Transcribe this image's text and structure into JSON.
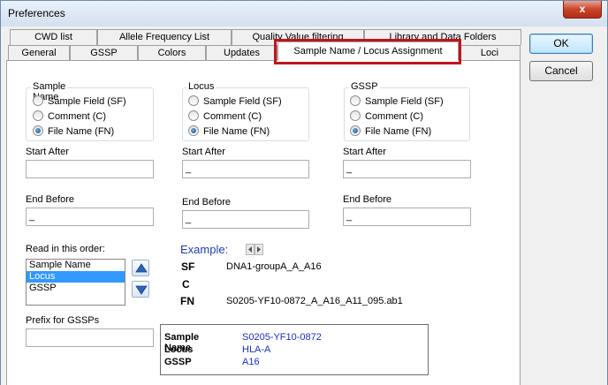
{
  "window": {
    "title": "Preferences",
    "close_glyph": "x"
  },
  "tabs_row_back": [
    "CWD list",
    "Allele Frequency List",
    "Quality Value filtering",
    "Library and Data Folders"
  ],
  "tabs_row_front": [
    "General",
    "GSSP",
    "Colors",
    "Updates",
    "Sample Name / Locus Assignment",
    "Loci"
  ],
  "buttons": {
    "ok": "OK",
    "cancel": "Cancel"
  },
  "groups": {
    "sample_name": {
      "label": "Sample Name",
      "options": [
        "Sample Field (SF)",
        "Comment (C)",
        "File Name (FN)"
      ],
      "selected": "File Name (FN)"
    },
    "locus": {
      "label": "Locus",
      "options": [
        "Sample Field (SF)",
        "Comment (C)",
        "File Name (FN)"
      ],
      "selected": "File Name (FN)"
    },
    "gssp": {
      "label": "GSSP",
      "options": [
        "Sample Field (SF)",
        "Comment (C)",
        "File Name (FN)"
      ],
      "selected": "File Name (FN)"
    }
  },
  "fields": {
    "start_after_label": "Start After",
    "end_before_label": "End Before",
    "sample_name_start": "",
    "sample_name_end": "_",
    "locus_start": "_",
    "locus_end": "_",
    "gssp_start": "_",
    "gssp_end": "_"
  },
  "read_order": {
    "label": "Read in this order:",
    "items": [
      "Sample Name",
      "Locus",
      "GSSP"
    ],
    "selected": "Locus"
  },
  "prefix": {
    "label": "Prefix for GSSPs",
    "value": ""
  },
  "example": {
    "label": "Example:",
    "rows": [
      {
        "key": "SF",
        "value": "DNA1-groupA_A_A16"
      },
      {
        "key": "C",
        "value": ""
      },
      {
        "key": "FN",
        "value": "S0205-YF10-0872_A_A16_A11_095.ab1"
      }
    ]
  },
  "result": [
    {
      "key": "Sample Name",
      "value": "S0205-YF10-0872"
    },
    {
      "key": "Locus",
      "value": "HLA-A"
    },
    {
      "key": "GSSP",
      "value": "A16"
    }
  ],
  "colors": {
    "highlight": "#c0141c",
    "example_blue": "#1f3fa8",
    "result_blue": "#1b2fbd",
    "selection": "#3399ff"
  }
}
